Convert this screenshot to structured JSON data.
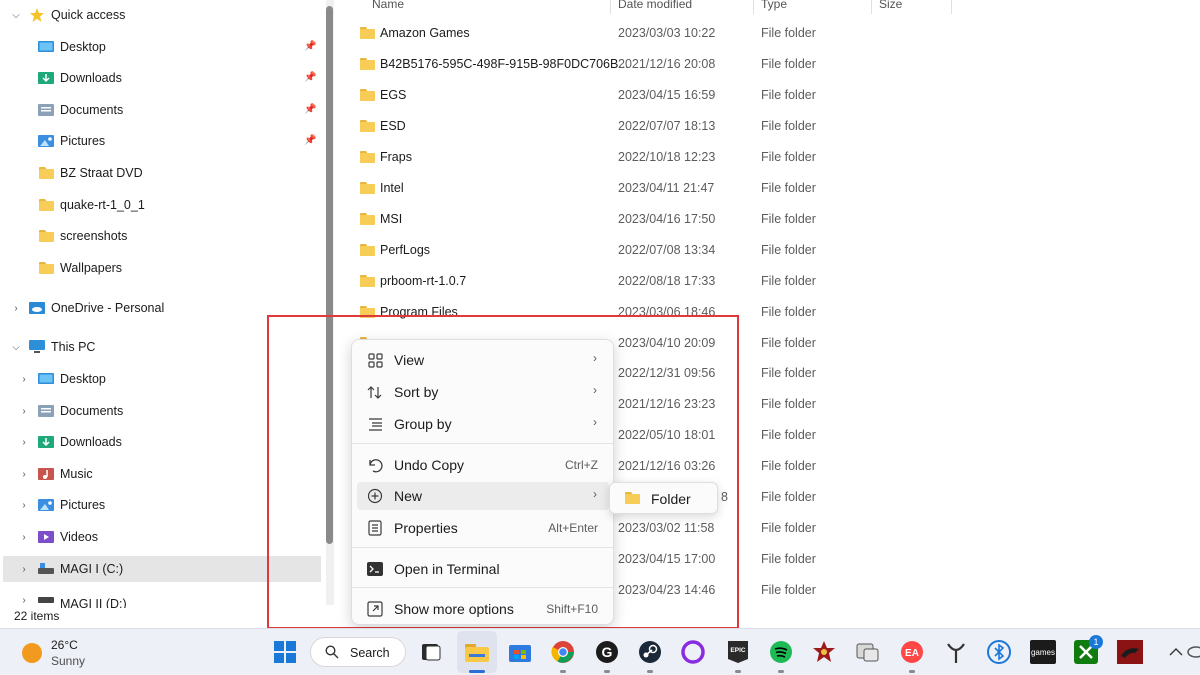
{
  "navigation": {
    "quick_access": "Quick access",
    "pinned": [
      {
        "label": "Desktop",
        "icon": "desktop-icon"
      },
      {
        "label": "Downloads",
        "icon": "downloads-icon"
      },
      {
        "label": "Documents",
        "icon": "documents-icon"
      },
      {
        "label": "Pictures",
        "icon": "pictures-icon"
      }
    ],
    "recent": [
      {
        "label": "BZ Straat DVD"
      },
      {
        "label": "quake-rt-1_0_1"
      },
      {
        "label": "screenshots"
      },
      {
        "label": "Wallpapers"
      }
    ],
    "onedrive": "OneDrive - Personal",
    "this_pc": "This PC",
    "pc_items": [
      {
        "label": "Desktop",
        "icon": "desktop-icon"
      },
      {
        "label": "Documents",
        "icon": "documents-icon"
      },
      {
        "label": "Downloads",
        "icon": "downloads-icon"
      },
      {
        "label": "Music",
        "icon": "music-icon"
      },
      {
        "label": "Pictures",
        "icon": "pictures-icon"
      },
      {
        "label": "Videos",
        "icon": "videos-icon"
      },
      {
        "label": "MAGI I (C:)",
        "icon": "drive-icon"
      },
      {
        "label": "MAGI II (D:)",
        "icon": "drive-icon"
      }
    ]
  },
  "columns": {
    "name": "Name",
    "date": "Date modified",
    "type": "Type",
    "size": "Size"
  },
  "files": [
    {
      "name": "Amazon Games",
      "date": "2023/03/03 10:22",
      "type": "File folder"
    },
    {
      "name": "B42B5176-595C-498F-915B-98F0DC706B...",
      "date": "2021/12/16 20:08",
      "type": "File folder"
    },
    {
      "name": "EGS",
      "date": "2023/04/15 16:59",
      "type": "File folder"
    },
    {
      "name": "ESD",
      "date": "2022/07/07 18:13",
      "type": "File folder"
    },
    {
      "name": "Fraps",
      "date": "2022/10/18 12:23",
      "type": "File folder"
    },
    {
      "name": "Intel",
      "date": "2023/04/11 21:47",
      "type": "File folder"
    },
    {
      "name": "MSI",
      "date": "2023/04/16 17:50",
      "type": "File folder"
    },
    {
      "name": "PerfLogs",
      "date": "2022/07/08 13:34",
      "type": "File folder"
    },
    {
      "name": "prboom-rt-1.0.7",
      "date": "2022/08/18 17:33",
      "type": "File folder"
    },
    {
      "name": "Program Files",
      "date": "2023/03/06 18:46",
      "type": "File folder"
    },
    {
      "name": "",
      "date": "2023/04/10 20:09",
      "type": "File folder"
    },
    {
      "name": "",
      "date": "2022/12/31 09:56",
      "type": "File folder"
    },
    {
      "name": "",
      "date": "2021/12/16 23:23",
      "type": "File folder"
    },
    {
      "name": "",
      "date": "2022/05/10 18:01",
      "type": "File folder"
    },
    {
      "name": "",
      "date": "2021/12/16 03:26",
      "type": "File folder"
    },
    {
      "name": "",
      "date": "8",
      "type": "File folder"
    },
    {
      "name": "",
      "date": "2023/03/02 11:58",
      "type": "File folder"
    },
    {
      "name": "",
      "date": "2023/04/15 17:00",
      "type": "File folder"
    },
    {
      "name": "",
      "date": "2023/04/23 14:46",
      "type": "File folder"
    }
  ],
  "status": {
    "items": "22 items"
  },
  "context_menu": {
    "view": "View",
    "sort_by": "Sort by",
    "group_by": "Group by",
    "undo_copy": "Undo Copy",
    "undo_shortcut": "Ctrl+Z",
    "new": "New",
    "properties": "Properties",
    "properties_shortcut": "Alt+Enter",
    "open_terminal": "Open in Terminal",
    "show_more": "Show more options",
    "show_more_shortcut": "Shift+F10",
    "submenu_folder": "Folder"
  },
  "taskbar": {
    "temperature": "26°C",
    "condition": "Sunny",
    "search_label": "Search",
    "xbox_badge": "1",
    "epic_label": "EPIC",
    "games_label": "games"
  },
  "colors": {
    "highlight": "#e0393b",
    "accent": "#2b6fd6",
    "folder": "#f7cd57"
  }
}
